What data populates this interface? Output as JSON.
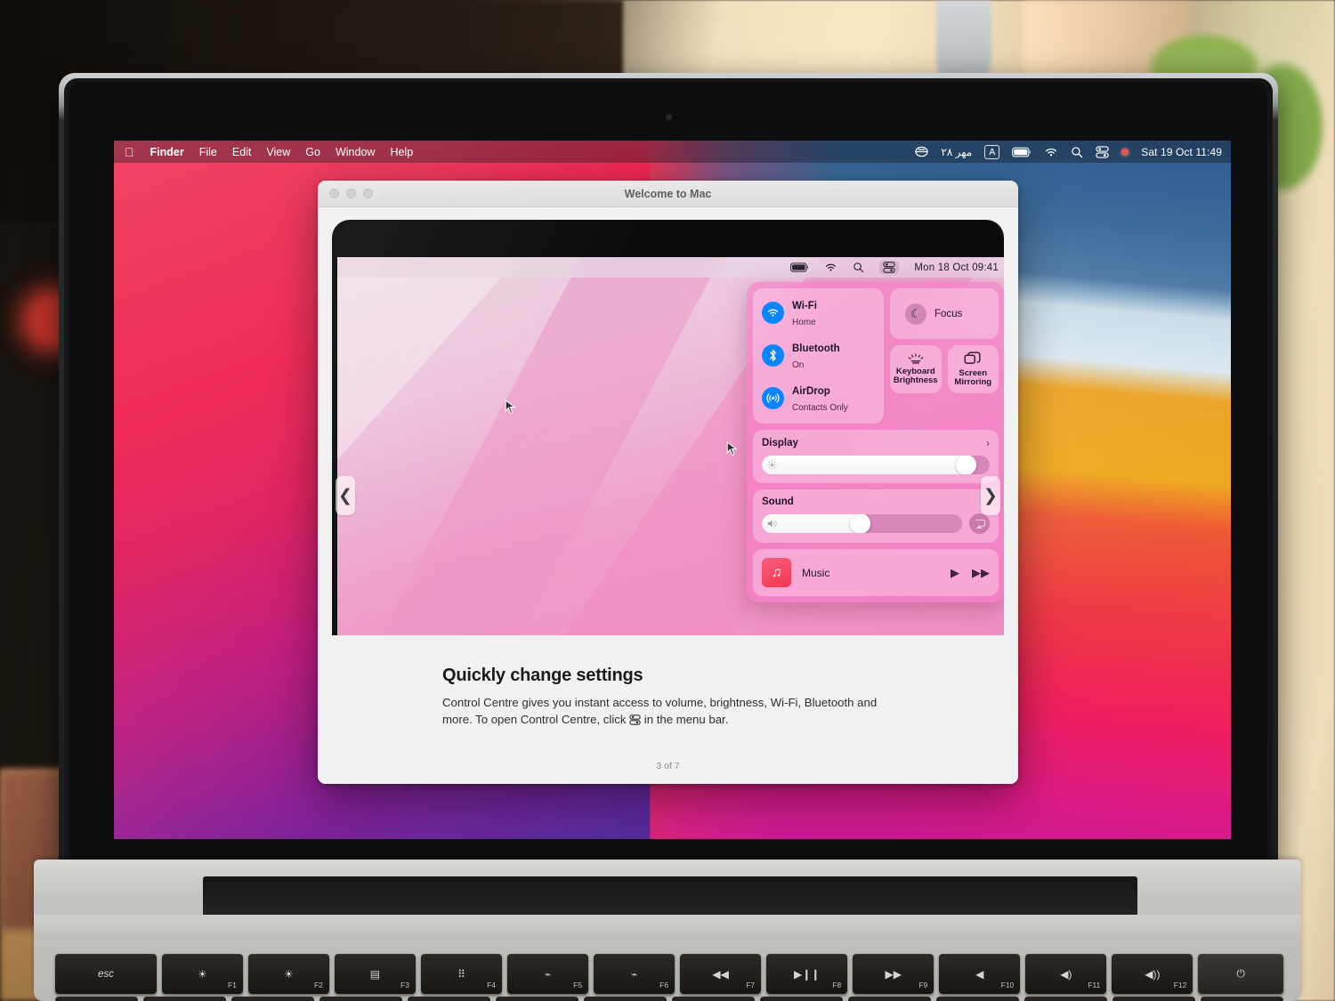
{
  "os_menubar": {
    "apple_icon": "apple-icon",
    "items": [
      "Finder",
      "File",
      "Edit",
      "View",
      "Go",
      "Window",
      "Help"
    ],
    "status": {
      "persian_date": "۲۸ مهر",
      "input_source": "A",
      "battery_icon": "battery-icon",
      "wifi_icon": "wifi-icon",
      "search_icon": "search-icon",
      "control_centre_icon": "control-centre-icon",
      "recording_dot": "red-dot-icon",
      "clock": "Sat 19 Oct  11:49"
    }
  },
  "window": {
    "title": "Welcome to Mac",
    "traffic_lights": [
      "close",
      "minimise",
      "zoom"
    ],
    "nav": {
      "prev": "❮",
      "next": "❯"
    },
    "page_indicator": "3 of 7",
    "caption": {
      "heading": "Quickly change settings",
      "body_before": "Control Centre gives you instant access to volume, brightness, Wi-Fi, Bluetooth and more. To open Control Centre, click ",
      "body_after": " in the menu bar."
    }
  },
  "mock_menubar": {
    "battery_icon": "battery-icon",
    "wifi_icon": "wifi-icon",
    "search_icon": "search-icon",
    "control_centre_icon": "control-centre-icon",
    "clock": "Mon 18 Oct  09:41"
  },
  "control_centre": {
    "toggles": [
      {
        "name": "Wi-Fi",
        "status": "Home",
        "icon": "wifi-icon"
      },
      {
        "name": "Bluetooth",
        "status": "On",
        "icon": "bluetooth-icon"
      },
      {
        "name": "AirDrop",
        "status": "Contacts Only",
        "icon": "airdrop-icon"
      }
    ],
    "focus": {
      "label": "Focus",
      "icon": "moon-icon"
    },
    "tiles": [
      {
        "label": "Keyboard\nBrightness",
        "line1": "Keyboard",
        "line2": "Brightness",
        "icon": "keyboard-brightness-icon"
      },
      {
        "label": "Screen\nMirroring",
        "line1": "Screen",
        "line2": "Mirroring",
        "icon": "screen-mirroring-icon"
      }
    ],
    "display": {
      "label": "Display",
      "chevron": "›",
      "value_pct": 93,
      "icon": "brightness-icon"
    },
    "sound": {
      "label": "Sound",
      "value_pct": 50,
      "icon": "speaker-icon",
      "airplay_icon": "airplay-icon"
    },
    "music": {
      "label": "Music",
      "art_icon": "music-note-icon",
      "play_icon": "play-icon",
      "next_icon": "fast-forward-icon"
    },
    "accent_color": "#0a84ff",
    "panel_color": "#f578c3"
  },
  "keyboard": {
    "keys": [
      {
        "label": "esc",
        "glyph": "esc",
        "fn": ""
      },
      {
        "label": "brightness-down",
        "glyph": "☀",
        "fn": "F1"
      },
      {
        "label": "brightness-up",
        "glyph": "☀",
        "fn": "F2"
      },
      {
        "label": "mission-control",
        "glyph": "▤",
        "fn": "F3"
      },
      {
        "label": "launchpad",
        "glyph": "⠿",
        "fn": "F4"
      },
      {
        "label": "keyboard-backlight-down",
        "glyph": "⌁",
        "fn": "F5"
      },
      {
        "label": "keyboard-backlight-up",
        "glyph": "⌁",
        "fn": "F6"
      },
      {
        "label": "rewind",
        "glyph": "◀◀",
        "fn": "F7"
      },
      {
        "label": "play-pause",
        "glyph": "▶❙❙",
        "fn": "F8"
      },
      {
        "label": "fast-forward",
        "glyph": "▶▶",
        "fn": "F9"
      },
      {
        "label": "mute",
        "glyph": "◀",
        "fn": "F10"
      },
      {
        "label": "volume-down",
        "glyph": "◀)",
        "fn": "F11"
      },
      {
        "label": "volume-up",
        "glyph": "◀))",
        "fn": "F12"
      },
      {
        "label": "power",
        "glyph": "⏻",
        "fn": ""
      }
    ]
  }
}
